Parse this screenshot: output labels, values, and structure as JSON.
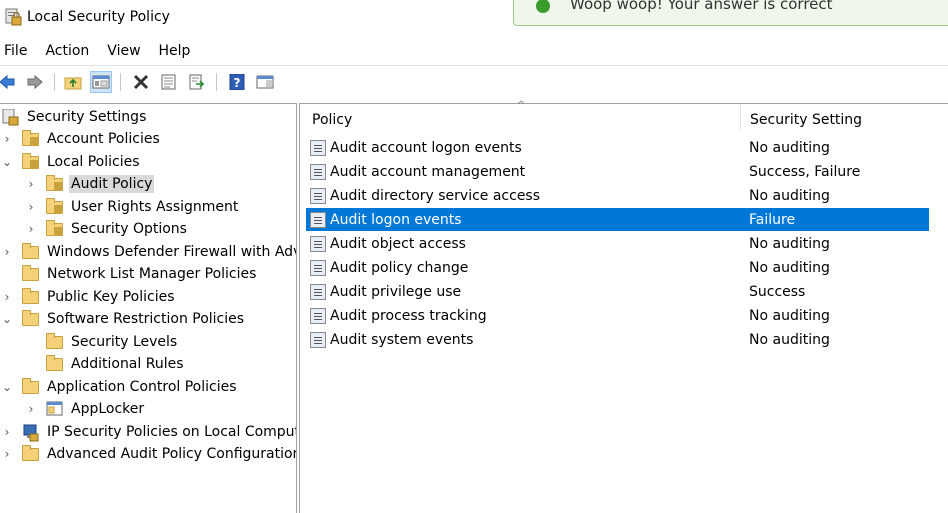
{
  "window": {
    "title": "Local Security Policy",
    "icon": "security-policy-icon"
  },
  "toast": {
    "message": "Woop woop! Your answer is correct",
    "icon": "check-circle-icon",
    "accent": "#3a9a2a"
  },
  "menu": {
    "items": [
      "File",
      "Action",
      "View",
      "Help"
    ]
  },
  "toolbar": {
    "buttons": [
      {
        "name": "back-button",
        "icon": "arrow-left-icon"
      },
      {
        "name": "forward-button",
        "icon": "arrow-right-icon"
      },
      {
        "name": "up-one-level-button",
        "icon": "folder-up-icon"
      },
      {
        "name": "show-hide-tree-button",
        "icon": "console-tree-icon"
      },
      {
        "name": "delete-button",
        "icon": "delete-x-icon"
      },
      {
        "name": "properties-button",
        "icon": "properties-icon"
      },
      {
        "name": "export-list-button",
        "icon": "export-icon"
      },
      {
        "name": "help-button",
        "icon": "help-icon"
      },
      {
        "name": "show-action-pane-button",
        "icon": "action-pane-icon"
      }
    ]
  },
  "tree": {
    "items": [
      {
        "label": "Security Settings",
        "expander": ""
      },
      {
        "label": "Account Policies",
        "expander": "›"
      },
      {
        "label": "Local Policies",
        "expander": "⌄"
      },
      {
        "label": "Audit Policy",
        "expander": "›",
        "selected": true
      },
      {
        "label": "User Rights Assignment",
        "expander": "›"
      },
      {
        "label": "Security Options",
        "expander": "›"
      },
      {
        "label": "Windows Defender Firewall with Adva",
        "expander": "›"
      },
      {
        "label": "Network List Manager Policies",
        "expander": ""
      },
      {
        "label": "Public Key Policies",
        "expander": "›"
      },
      {
        "label": "Software Restriction Policies",
        "expander": "⌄"
      },
      {
        "label": "Security Levels",
        "expander": ""
      },
      {
        "label": "Additional Rules",
        "expander": ""
      },
      {
        "label": "Application Control Policies",
        "expander": "⌄"
      },
      {
        "label": "AppLocker",
        "expander": "›"
      },
      {
        "label": "IP Security Policies on Local Compute",
        "expander": "›"
      },
      {
        "label": "Advanced Audit Policy Configuration",
        "expander": "›"
      }
    ]
  },
  "list": {
    "columns": {
      "policy": "Policy",
      "setting": "Security Setting"
    },
    "sort_indicator": "^",
    "rows": [
      {
        "policy": "Audit account logon events",
        "setting": "No auditing"
      },
      {
        "policy": "Audit account management",
        "setting": "Success, Failure"
      },
      {
        "policy": "Audit directory service access",
        "setting": "No auditing"
      },
      {
        "policy": "Audit logon events",
        "setting": "Failure",
        "selected": true
      },
      {
        "policy": "Audit object access",
        "setting": "No auditing"
      },
      {
        "policy": "Audit policy change",
        "setting": "No auditing"
      },
      {
        "policy": "Audit privilege use",
        "setting": "Success"
      },
      {
        "policy": "Audit process tracking",
        "setting": "No auditing"
      },
      {
        "policy": "Audit system events",
        "setting": "No auditing"
      }
    ]
  },
  "colors": {
    "selection": "#0078d7",
    "tree_selection": "#d9d9d9",
    "folder": "#f5d27a"
  }
}
